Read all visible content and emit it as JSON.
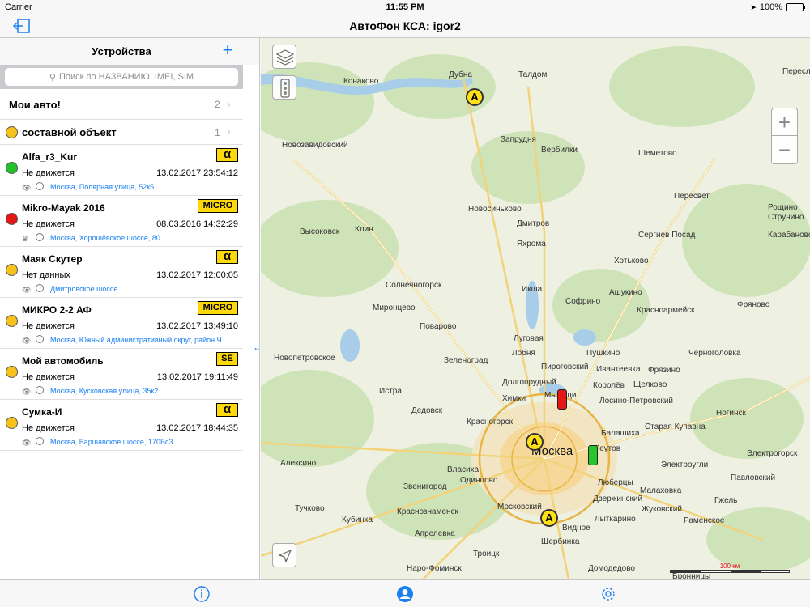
{
  "status_bar": {
    "carrier": "Carrier",
    "time": "11:55 PM",
    "battery": "100%"
  },
  "nav_bar": {
    "title": "АвтоФон КСА: igor2"
  },
  "sidebar": {
    "title": "Устройства",
    "add": "+",
    "search_placeholder": "Поиск по НАЗВАНИЮ, IMEI, SIM",
    "group": {
      "label": "Мои авто!",
      "count": "2"
    },
    "subgroup": {
      "label": "составной объект",
      "count": "1"
    },
    "devices": [
      {
        "name": "Alfa_r3_Kur",
        "badge": "α",
        "status": "Не движется",
        "date": "13.02.2017 23:54:12",
        "address": "Москва, Полярная улица, 52к5",
        "color": "green"
      },
      {
        "name": "Mikro-Mayak 2016",
        "badge": "MICRO",
        "status": "Не движется",
        "date": "08.03.2016 14:32:29",
        "address": "Москва, Хорошёвское шоссе, 80",
        "color": "red"
      },
      {
        "name": "Маяк Скутер",
        "badge": "α",
        "status": "Нет данных",
        "date": "13.02.2017 12:00:05",
        "address": "Дмитровское шоссе",
        "color": "yellow"
      },
      {
        "name": "МИКРО 2-2 АФ",
        "badge": "MICRO",
        "status": "Не движется",
        "date": "13.02.2017 13:49:10",
        "address": "Москва, Южный административный округ, район Ч...",
        "color": "yellow"
      },
      {
        "name": "Мой автомобиль",
        "badge": "SE",
        "status": "Не движется",
        "date": "13.02.2017 19:11:49",
        "address": "Москва, Кусковская улица, 35к2",
        "color": "yellow"
      },
      {
        "name": "Сумка-И",
        "badge": "α",
        "status": "Не движется",
        "date": "13.02.2017 18:44:35",
        "address": "Москва, Варшавское шоссе, 170Бс3",
        "color": "yellow"
      }
    ]
  },
  "map": {
    "places": {
      "dubna": "Дубна",
      "taldom": "Талдом",
      "konakovo": "Конаково",
      "zaprudnya": "Запрудня",
      "verbilki": "Вербилки",
      "novozavidovsky": "Новозавидовский",
      "shemetovo": "Шеметово",
      "novosinkovo": "Новосиньково",
      "klin": "Клин",
      "dmitrov": "Дмитров",
      "vysokovsk": "Высоковск",
      "sergiev": "Сергиев Посад",
      "khotkovo": "Хотьково",
      "yakhroma": "Яхрома",
      "solnechnogorsk": "Солнечногорск",
      "iksha": "Икша",
      "sofrino": "Софрино",
      "krasnoarmeysk": "Красноармейск",
      "fryanovo": "Фряново",
      "ashukino": "Ашукино",
      "mironcevo": "Миронцево",
      "povarovo": "Поварово",
      "lugovaya": "Луговая",
      "zelenograd": "Зеленоград",
      "lobnya": "Лобня",
      "pushkino": "Пушкино",
      "chernogolovka": "Черноголовка",
      "pirogovsky": "Пироговский",
      "ivanteevka": "Ивантеевка",
      "fryazino": "Фрязино",
      "dolgoprudny": "Долгопрудный",
      "korolev": "Королёв",
      "shchelkovo": "Щелково",
      "istra": "Истра",
      "khimki": "Химки",
      "mytishchi": "Мытищи",
      "losino": "Лосино-Петровский",
      "dedovsk": "Дедовск",
      "krasnogorsk": "Красногорск",
      "balashikha": "Балашиха",
      "noginsk": "Ногинск",
      "kupavna": "Старая Купавна",
      "moskva": "Москва",
      "reutov": "Реутов",
      "elektrougli": "Электроугли",
      "vlasikha": "Власиха",
      "odintsovo": "Одинцово",
      "lyubertsy": "Люберцы",
      "zvenigorod": "Звенигород",
      "dzerzhinsky": "Дзержинский",
      "malakhovka": "Малаховка",
      "moskovsky": "Московский",
      "zhukovsky": "Жуковский",
      "kubinka": "Кубинка",
      "krasnoznamensk": "Краснознаменск",
      "lytkarino": "Лыткарино",
      "aprelevka": "Апрелевка",
      "vidnoe": "Видное",
      "ramenskoe": "Раменское",
      "shcherbinka": "Щербинка",
      "troitsk": "Троицк",
      "domodedovo": "Домодедово",
      "bronnicy": "Бронницы",
      "pereslavl": "Пересла",
      "rosshino": "Рощино",
      "strunino": "Струнино",
      "karabanovo": "Карабаново",
      "peresvet": "Пересвет",
      "elektrogorsk": "Электрогорск",
      "pavlovsky": "Павловский",
      "tuchkovo": "Тучково",
      "novopetrovskoe": "Новопетровское",
      "aleksino": "Алексино",
      "naro": "Наро-Фоминск",
      "gzhel": "Гжель"
    },
    "scale_label": "100 км",
    "zoom_in": "+",
    "zoom_out": "−"
  },
  "colors": {
    "accent": "#1a7ff0",
    "badge": "#fdd80a",
    "marker": "#fde018"
  }
}
